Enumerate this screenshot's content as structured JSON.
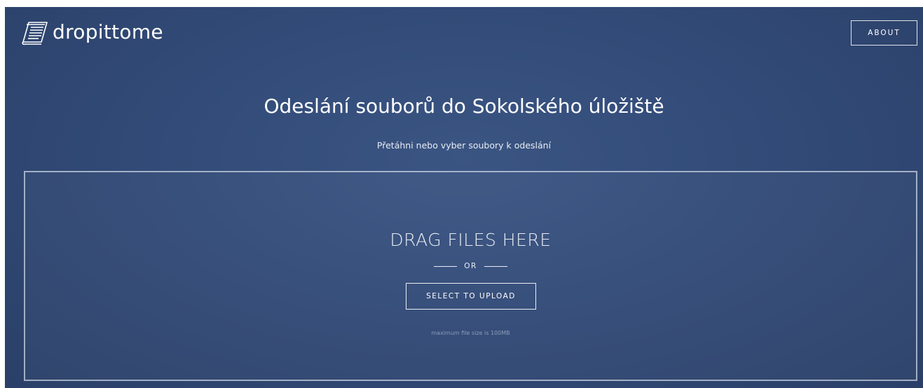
{
  "header": {
    "logo_text": "dropittome",
    "logo_icon": "document-stack-icon",
    "about_label": "ABOUT"
  },
  "main": {
    "title": "Odeslání souborů do Sokolského úložiště",
    "subtitle": "Přetáhni nebo vyber soubory k odeslání"
  },
  "dropzone": {
    "drag_text": "DRAG FILES HERE",
    "or_text": "OR",
    "select_label": "SELECT TO UPLOAD",
    "max_size_text": "maximum file size is 100MB"
  },
  "colors": {
    "background": "#324b78",
    "text": "#ffffff",
    "muted_text": "#8d9cb8",
    "border": "#c8d2e1"
  }
}
